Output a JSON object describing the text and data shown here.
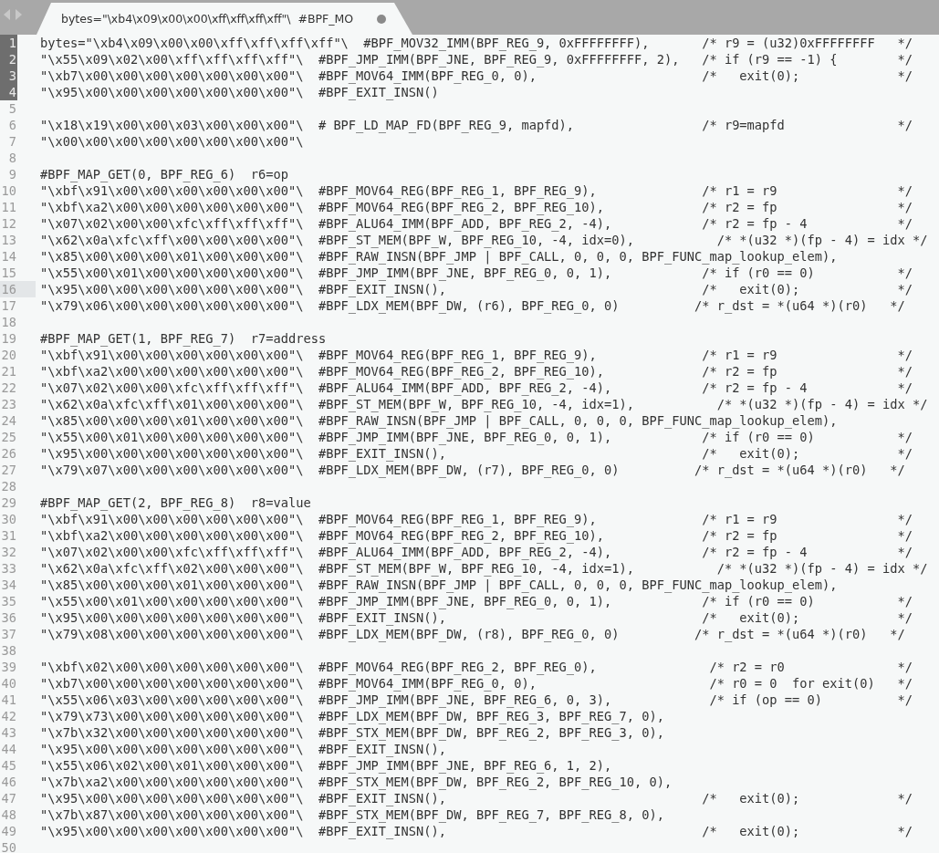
{
  "tab": {
    "title": "bytes=\"\\xb4\\x09\\x00\\x00\\xff\\xff\\xff\\xff\"\\  #BPF_MO",
    "modified": true,
    "selected": true
  },
  "lines": [
    {
      "number": "1",
      "marked": true,
      "current": false,
      "text": "bytes=\"\\xb4\\x09\\x00\\x00\\xff\\xff\\xff\\xff\"\\  #BPF_MOV32_IMM(BPF_REG_9, 0xFFFFFFFF),       /* r9 = (u32)0xFFFFFFFF   */"
    },
    {
      "number": "2",
      "marked": true,
      "current": false,
      "text": "\"\\x55\\x09\\x02\\x00\\xff\\xff\\xff\\xff\"\\  #BPF_JMP_IMM(BPF_JNE, BPF_REG_9, 0xFFFFFFFF, 2),   /* if (r9 == -1) {        */"
    },
    {
      "number": "3",
      "marked": true,
      "current": false,
      "text": "\"\\xb7\\x00\\x00\\x00\\x00\\x00\\x00\\x00\"\\  #BPF_MOV64_IMM(BPF_REG_0, 0),                      /*   exit(0);             */"
    },
    {
      "number": "4",
      "marked": true,
      "current": false,
      "text": "\"\\x95\\x00\\x00\\x00\\x00\\x00\\x00\\x00\"\\  #BPF_EXIT_INSN()"
    },
    {
      "number": "5",
      "marked": false,
      "current": false
    },
    {
      "number": "6",
      "marked": false,
      "current": false,
      "text": "\"\\x18\\x19\\x00\\x00\\x03\\x00\\x00\\x00\"\\  # BPF_LD_MAP_FD(BPF_REG_9, mapfd),                 /* r9=mapfd               */"
    },
    {
      "number": "7",
      "marked": false,
      "current": false,
      "text": "\"\\x00\\x00\\x00\\x00\\x00\\x00\\x00\\x00\"\\"
    },
    {
      "number": "8",
      "marked": false,
      "current": false
    },
    {
      "number": "9",
      "marked": false,
      "current": false,
      "text": "#BPF_MAP_GET(0, BPF_REG_6)  r6=op"
    },
    {
      "number": "10",
      "marked": false,
      "current": false,
      "text": "\"\\xbf\\x91\\x00\\x00\\x00\\x00\\x00\\x00\"\\  #BPF_MOV64_REG(BPF_REG_1, BPF_REG_9),              /* r1 = r9                */"
    },
    {
      "number": "11",
      "marked": false,
      "current": false,
      "text": "\"\\xbf\\xa2\\x00\\x00\\x00\\x00\\x00\\x00\"\\  #BPF_MOV64_REG(BPF_REG_2, BPF_REG_10),             /* r2 = fp                */"
    },
    {
      "number": "12",
      "marked": false,
      "current": false,
      "text": "\"\\x07\\x02\\x00\\x00\\xfc\\xff\\xff\\xff\"\\  #BPF_ALU64_IMM(BPF_ADD, BPF_REG_2, -4),            /* r2 = fp - 4            */"
    },
    {
      "number": "13",
      "marked": false,
      "current": false,
      "text": "\"\\x62\\x0a\\xfc\\xff\\x00\\x00\\x00\\x00\"\\  #BPF_ST_MEM(BPF_W, BPF_REG_10, -4, idx=0),           /* *(u32 *)(fp - 4) = idx */"
    },
    {
      "number": "14",
      "marked": false,
      "current": false,
      "text": "\"\\x85\\x00\\x00\\x00\\x01\\x00\\x00\\x00\"\\  #BPF_RAW_INSN(BPF_JMP | BPF_CALL, 0, 0, 0, BPF_FUNC_map_lookup_elem),"
    },
    {
      "number": "15",
      "marked": false,
      "current": false,
      "text": "\"\\x55\\x00\\x01\\x00\\x00\\x00\\x00\\x00\"\\  #BPF_JMP_IMM(BPF_JNE, BPF_REG_0, 0, 1),            /* if (r0 == 0)           */"
    },
    {
      "number": "16",
      "marked": false,
      "current": true,
      "text": "\"\\x95\\x00\\x00\\x00\\x00\\x00\\x00\\x00\"\\  #BPF_EXIT_INSN(),                                  /*   exit(0);             */"
    },
    {
      "number": "17",
      "marked": false,
      "current": false,
      "text": "\"\\x79\\x06\\x00\\x00\\x00\\x00\\x00\\x00\"\\  #BPF_LDX_MEM(BPF_DW, (r6), BPF_REG_0, 0)          /* r_dst = *(u64 *)(r0)   */"
    },
    {
      "number": "18",
      "marked": false,
      "current": false
    },
    {
      "number": "19",
      "marked": false,
      "current": false,
      "text": "#BPF_MAP_GET(1, BPF_REG_7)  r7=address"
    },
    {
      "number": "20",
      "marked": false,
      "current": false,
      "text": "\"\\xbf\\x91\\x00\\x00\\x00\\x00\\x00\\x00\"\\  #BPF_MOV64_REG(BPF_REG_1, BPF_REG_9),              /* r1 = r9                */"
    },
    {
      "number": "21",
      "marked": false,
      "current": false,
      "text": "\"\\xbf\\xa2\\x00\\x00\\x00\\x00\\x00\\x00\"\\  #BPF_MOV64_REG(BPF_REG_2, BPF_REG_10),             /* r2 = fp                */"
    },
    {
      "number": "22",
      "marked": false,
      "current": false,
      "text": "\"\\x07\\x02\\x00\\x00\\xfc\\xff\\xff\\xff\"\\  #BPF_ALU64_IMM(BPF_ADD, BPF_REG_2, -4),            /* r2 = fp - 4            */"
    },
    {
      "number": "23",
      "marked": false,
      "current": false,
      "text": "\"\\x62\\x0a\\xfc\\xff\\x01\\x00\\x00\\x00\"\\  #BPF_ST_MEM(BPF_W, BPF_REG_10, -4, idx=1),           /* *(u32 *)(fp - 4) = idx */"
    },
    {
      "number": "24",
      "marked": false,
      "current": false,
      "text": "\"\\x85\\x00\\x00\\x00\\x01\\x00\\x00\\x00\"\\  #BPF_RAW_INSN(BPF_JMP | BPF_CALL, 0, 0, 0, BPF_FUNC_map_lookup_elem),"
    },
    {
      "number": "25",
      "marked": false,
      "current": false,
      "text": "\"\\x55\\x00\\x01\\x00\\x00\\x00\\x00\\x00\"\\  #BPF_JMP_IMM(BPF_JNE, BPF_REG_0, 0, 1),            /* if (r0 == 0)           */"
    },
    {
      "number": "26",
      "marked": false,
      "current": false,
      "text": "\"\\x95\\x00\\x00\\x00\\x00\\x00\\x00\\x00\"\\  #BPF_EXIT_INSN(),                                  /*   exit(0);             */"
    },
    {
      "number": "27",
      "marked": false,
      "current": false,
      "text": "\"\\x79\\x07\\x00\\x00\\x00\\x00\\x00\\x00\"\\  #BPF_LDX_MEM(BPF_DW, (r7), BPF_REG_0, 0)          /* r_dst = *(u64 *)(r0)   */"
    },
    {
      "number": "28",
      "marked": false,
      "current": false
    },
    {
      "number": "29",
      "marked": false,
      "current": false,
      "text": "#BPF_MAP_GET(2, BPF_REG_8)  r8=value"
    },
    {
      "number": "30",
      "marked": false,
      "current": false,
      "text": "\"\\xbf\\x91\\x00\\x00\\x00\\x00\\x00\\x00\"\\  #BPF_MOV64_REG(BPF_REG_1, BPF_REG_9),              /* r1 = r9                */"
    },
    {
      "number": "31",
      "marked": false,
      "current": false,
      "text": "\"\\xbf\\xa2\\x00\\x00\\x00\\x00\\x00\\x00\"\\  #BPF_MOV64_REG(BPF_REG_2, BPF_REG_10),             /* r2 = fp                */"
    },
    {
      "number": "32",
      "marked": false,
      "current": false,
      "text": "\"\\x07\\x02\\x00\\x00\\xfc\\xff\\xff\\xff\"\\  #BPF_ALU64_IMM(BPF_ADD, BPF_REG_2, -4),            /* r2 = fp - 4            */"
    },
    {
      "number": "33",
      "marked": false,
      "current": false,
      "text": "\"\\x62\\x0a\\xfc\\xff\\x02\\x00\\x00\\x00\"\\  #BPF_ST_MEM(BPF_W, BPF_REG_10, -4, idx=1),           /* *(u32 *)(fp - 4) = idx */"
    },
    {
      "number": "34",
      "marked": false,
      "current": false,
      "text": "\"\\x85\\x00\\x00\\x00\\x01\\x00\\x00\\x00\"\\  #BPF_RAW_INSN(BPF_JMP | BPF_CALL, 0, 0, 0, BPF_FUNC_map_lookup_elem),"
    },
    {
      "number": "35",
      "marked": false,
      "current": false,
      "text": "\"\\x55\\x00\\x01\\x00\\x00\\x00\\x00\\x00\"\\  #BPF_JMP_IMM(BPF_JNE, BPF_REG_0, 0, 1),            /* if (r0 == 0)           */"
    },
    {
      "number": "36",
      "marked": false,
      "current": false,
      "text": "\"\\x95\\x00\\x00\\x00\\x00\\x00\\x00\\x00\"\\  #BPF_EXIT_INSN(),                                  /*   exit(0);             */"
    },
    {
      "number": "37",
      "marked": false,
      "current": false,
      "text": "\"\\x79\\x08\\x00\\x00\\x00\\x00\\x00\\x00\"\\  #BPF_LDX_MEM(BPF_DW, (r8), BPF_REG_0, 0)          /* r_dst = *(u64 *)(r0)   */"
    },
    {
      "number": "38",
      "marked": false,
      "current": false
    },
    {
      "number": "39",
      "marked": false,
      "current": false,
      "text": "\"\\xbf\\x02\\x00\\x00\\x00\\x00\\x00\\x00\"\\  #BPF_MOV64_REG(BPF_REG_2, BPF_REG_0),               /* r2 = r0               */"
    },
    {
      "number": "40",
      "marked": false,
      "current": false,
      "text": "\"\\xb7\\x00\\x00\\x00\\x00\\x00\\x00\\x00\"\\  #BPF_MOV64_IMM(BPF_REG_0, 0),                       /* r0 = 0  for exit(0)   */"
    },
    {
      "number": "41",
      "marked": false,
      "current": false,
      "text": "\"\\x55\\x06\\x03\\x00\\x00\\x00\\x00\\x00\"\\  #BPF_JMP_IMM(BPF_JNE, BPF_REG_6, 0, 3),             /* if (op == 0)          */"
    },
    {
      "number": "42",
      "marked": false,
      "current": false,
      "text": "\"\\x79\\x73\\x00\\x00\\x00\\x00\\x00\\x00\"\\  #BPF_LDX_MEM(BPF_DW, BPF_REG_3, BPF_REG_7, 0),"
    },
    {
      "number": "43",
      "marked": false,
      "current": false,
      "text": "\"\\x7b\\x32\\x00\\x00\\x00\\x00\\x00\\x00\"\\  #BPF_STX_MEM(BPF_DW, BPF_REG_2, BPF_REG_3, 0),"
    },
    {
      "number": "44",
      "marked": false,
      "current": false,
      "text": "\"\\x95\\x00\\x00\\x00\\x00\\x00\\x00\\x00\"\\  #BPF_EXIT_INSN(),"
    },
    {
      "number": "45",
      "marked": false,
      "current": false,
      "text": "\"\\x55\\x06\\x02\\x00\\x01\\x00\\x00\\x00\"\\  #BPF_JMP_IMM(BPF_JNE, BPF_REG_6, 1, 2),"
    },
    {
      "number": "46",
      "marked": false,
      "current": false,
      "text": "\"\\x7b\\xa2\\x00\\x00\\x00\\x00\\x00\\x00\"\\  #BPF_STX_MEM(BPF_DW, BPF_REG_2, BPF_REG_10, 0),"
    },
    {
      "number": "47",
      "marked": false,
      "current": false,
      "text": "\"\\x95\\x00\\x00\\x00\\x00\\x00\\x00\\x00\"\\  #BPF_EXIT_INSN(),                                  /*   exit(0);             */"
    },
    {
      "number": "48",
      "marked": false,
      "current": false,
      "text": "\"\\x7b\\x87\\x00\\x00\\x00\\x00\\x00\\x00\"\\  #BPF_STX_MEM(BPF_DW, BPF_REG_7, BPF_REG_8, 0),"
    },
    {
      "number": "49",
      "marked": false,
      "current": false,
      "text": "\"\\x95\\x00\\x00\\x00\\x00\\x00\\x00\\x00\"\\  #BPF_EXIT_INSN(),                                  /*   exit(0);             */"
    },
    {
      "number": "50",
      "marked": false,
      "current": false
    }
  ]
}
